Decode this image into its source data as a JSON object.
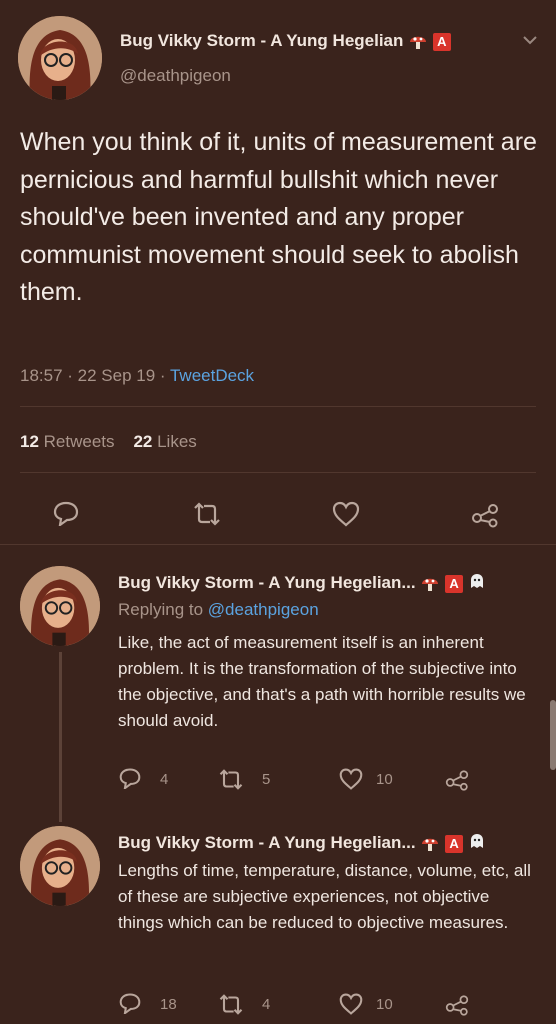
{
  "main_tweet": {
    "display_name": "Bug Vikky Storm - A Yung Hegelian",
    "handle": "@deathpigeon",
    "badge": "A",
    "text": "When you think of it, units of measurement are pernicious and harmful bullshit which never should've been invented and any proper communist movement should seek to abolish them.",
    "time": "18:57 · 22 Sep 19 ·",
    "source": "TweetDeck",
    "retweets_count": "12",
    "retweets_label": "Retweets",
    "likes_count": "22",
    "likes_label": "Likes"
  },
  "replies": [
    {
      "display_name": "Bug Vikky Storm - A Yung Hegelian...",
      "badge": "A",
      "replying_prefix": "Replying to",
      "replying_handle": "@deathpigeon",
      "text": "Like, the act of measurement itself is an inherent problem. It is the transformation of the subjective into the objective, and that's a path with horrible results we should avoid.",
      "reply_count": "4",
      "retweet_count": "5",
      "like_count": "10"
    },
    {
      "display_name": "Bug Vikky Storm - A Yung Hegelian...",
      "badge": "A",
      "text": "Lengths of time, temperature, distance, volume, etc, all of these are subjective experiences, not objective things which can be reduced to objective measures.",
      "reply_count": "18",
      "retweet_count": "4",
      "like_count": "10"
    }
  ],
  "colors": {
    "background": "#3a231c",
    "link": "#5ba3e0",
    "badge": "#d9342b"
  },
  "icons": [
    "mushroom-icon",
    "chevron-down-icon",
    "reply-icon",
    "retweet-icon",
    "like-icon",
    "share-icon",
    "ghost-icon"
  ]
}
